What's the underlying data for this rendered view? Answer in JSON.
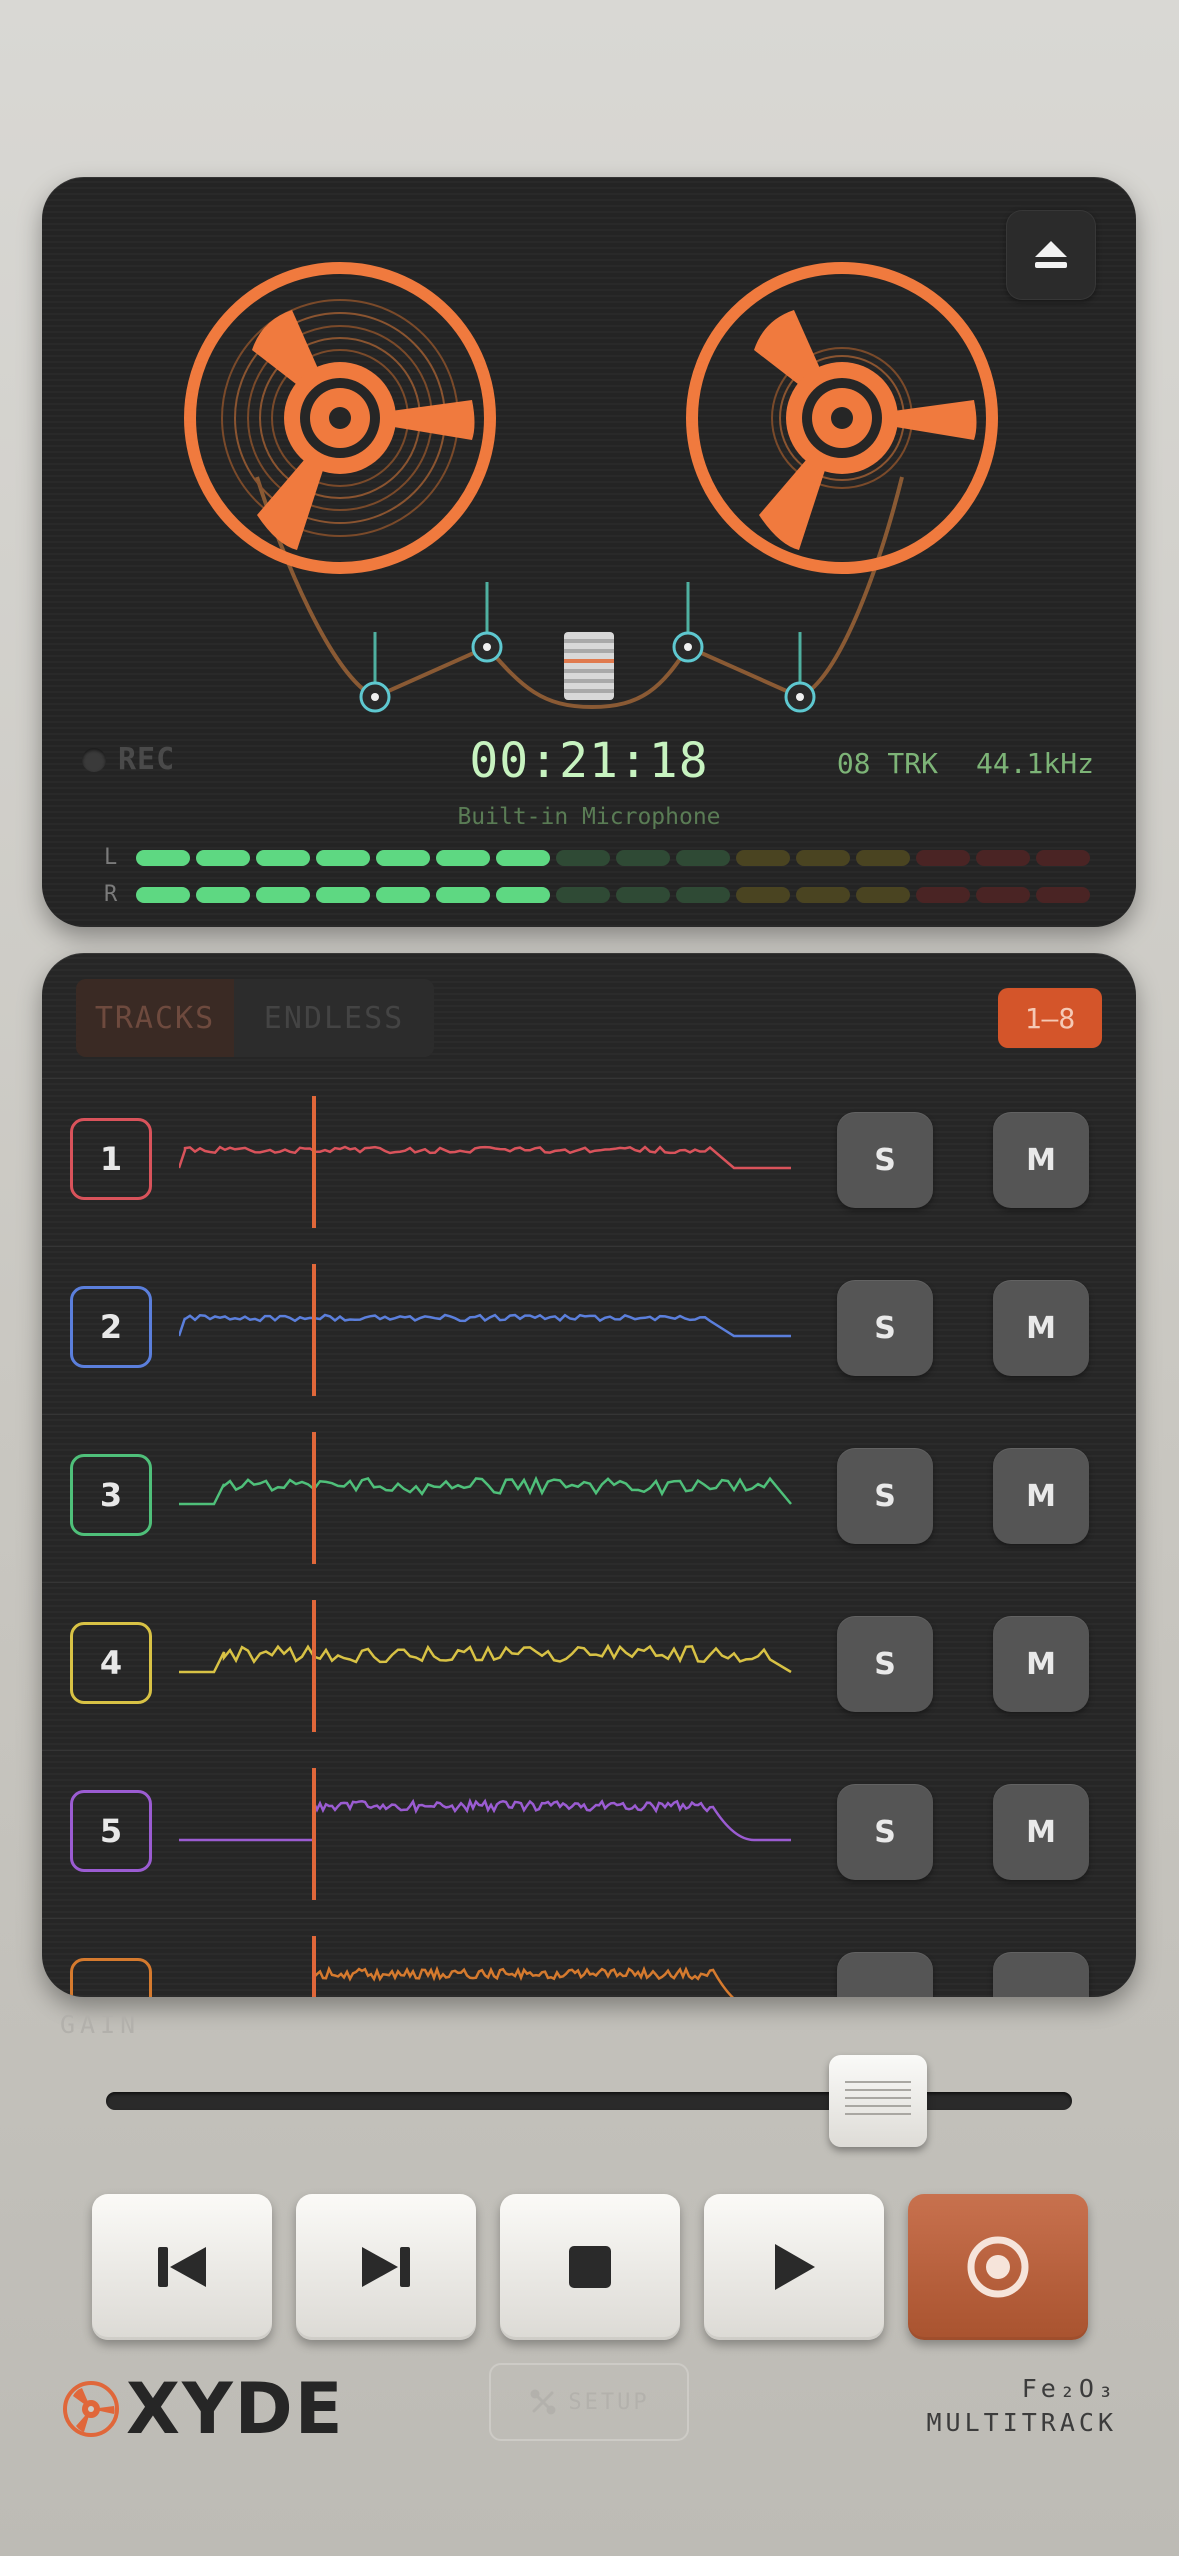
{
  "deck": {
    "rec_label": "REC",
    "time": "00:21:18",
    "track_count": "08 TRK",
    "sample_rate": "44.1kHz",
    "input_source": "Built-in Microphone",
    "meter_left_label": "L",
    "meter_right_label": "R",
    "meter_left_level_segments": 7,
    "meter_right_level_segments": 7,
    "meter_total_segments": 16
  },
  "panel": {
    "tabs": [
      {
        "label": "TRACKS"
      },
      {
        "label": "ENDLESS"
      }
    ],
    "range_label": "1–8",
    "tracks": [
      {
        "number": "1",
        "color": "#d9535b",
        "solo": "S",
        "mute": "M"
      },
      {
        "number": "2",
        "color": "#5b7fdc",
        "solo": "S",
        "mute": "M"
      },
      {
        "number": "3",
        "color": "#4fc07a",
        "solo": "S",
        "mute": "M"
      },
      {
        "number": "4",
        "color": "#d8c245",
        "solo": "S",
        "mute": "M"
      },
      {
        "number": "5",
        "color": "#9b5cd2",
        "solo": "S",
        "mute": "M"
      },
      {
        "number": "",
        "color": "#d57a2e",
        "solo": "",
        "mute": ""
      }
    ]
  },
  "gain": {
    "label": "GAIN",
    "value": 0.8
  },
  "footer": {
    "brand": "XYDE",
    "setup_label": "SETUP",
    "model_line1": "Fe₂O₃",
    "model_line2": "MULTITRACK"
  },
  "colors": {
    "accent": "#f07a3e",
    "record": "#b85e39",
    "meter_green": "#5ed882",
    "meter_yellow": "#4a4421",
    "meter_red": "#4a2424"
  },
  "icons": {
    "eject": "eject-icon",
    "prev": "skip-back-icon",
    "next": "skip-forward-icon",
    "stop": "stop-icon",
    "play": "play-icon",
    "record": "record-icon",
    "setup": "tools-icon"
  }
}
